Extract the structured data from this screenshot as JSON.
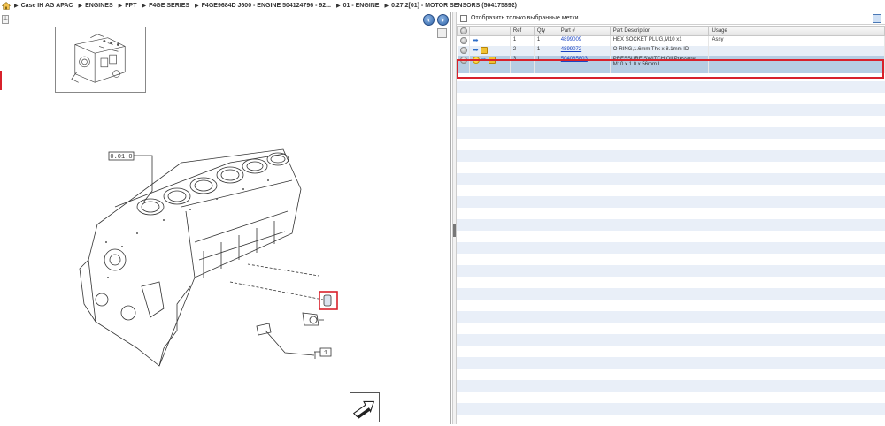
{
  "breadcrumb": {
    "items": [
      "Case IH AG APAC",
      "ENGINES",
      "FPT",
      "F4GE SERIES",
      "F4GE9684D J600 - ENGINE 504124796 - 92...",
      "01 - ENGINE",
      "0.27.2[01] - MOTOR SENSORS (504175892)"
    ]
  },
  "diagram": {
    "callout_main": "0.01.0",
    "callout_ref": "1",
    "icons": {
      "home": "home-icon",
      "prev": "arrow-left-icon",
      "next": "arrow-right-icon",
      "next_page": "next-page-arrow-icon"
    }
  },
  "parts_panel": {
    "filter_label": "Отобразить только выбранные метки",
    "columns": [
      "Ref",
      "Qty",
      "Part #",
      "Part Description",
      "Usage"
    ],
    "rows": [
      {
        "ref": "1",
        "qty": "1",
        "part": "4899009",
        "desc": "HEX SOCKET PLUG,M10 x1",
        "usage": "Assy"
      },
      {
        "ref": "2",
        "qty": "1",
        "part": "4899072",
        "desc": "O-RING,1.6mm Thk x 8.1mm ID",
        "usage": ""
      },
      {
        "ref": "3",
        "qty": "1",
        "part": "504085803",
        "desc": "PRESSURE SWITCH,Oil Pressure, M10 x 1.0 x 56mm L",
        "usage": ""
      }
    ]
  },
  "colors": {
    "accent_red": "#d8212b",
    "link_blue": "#1a44c4",
    "selected_row": "#b6cde3",
    "alt_row": "#e7eef7"
  }
}
